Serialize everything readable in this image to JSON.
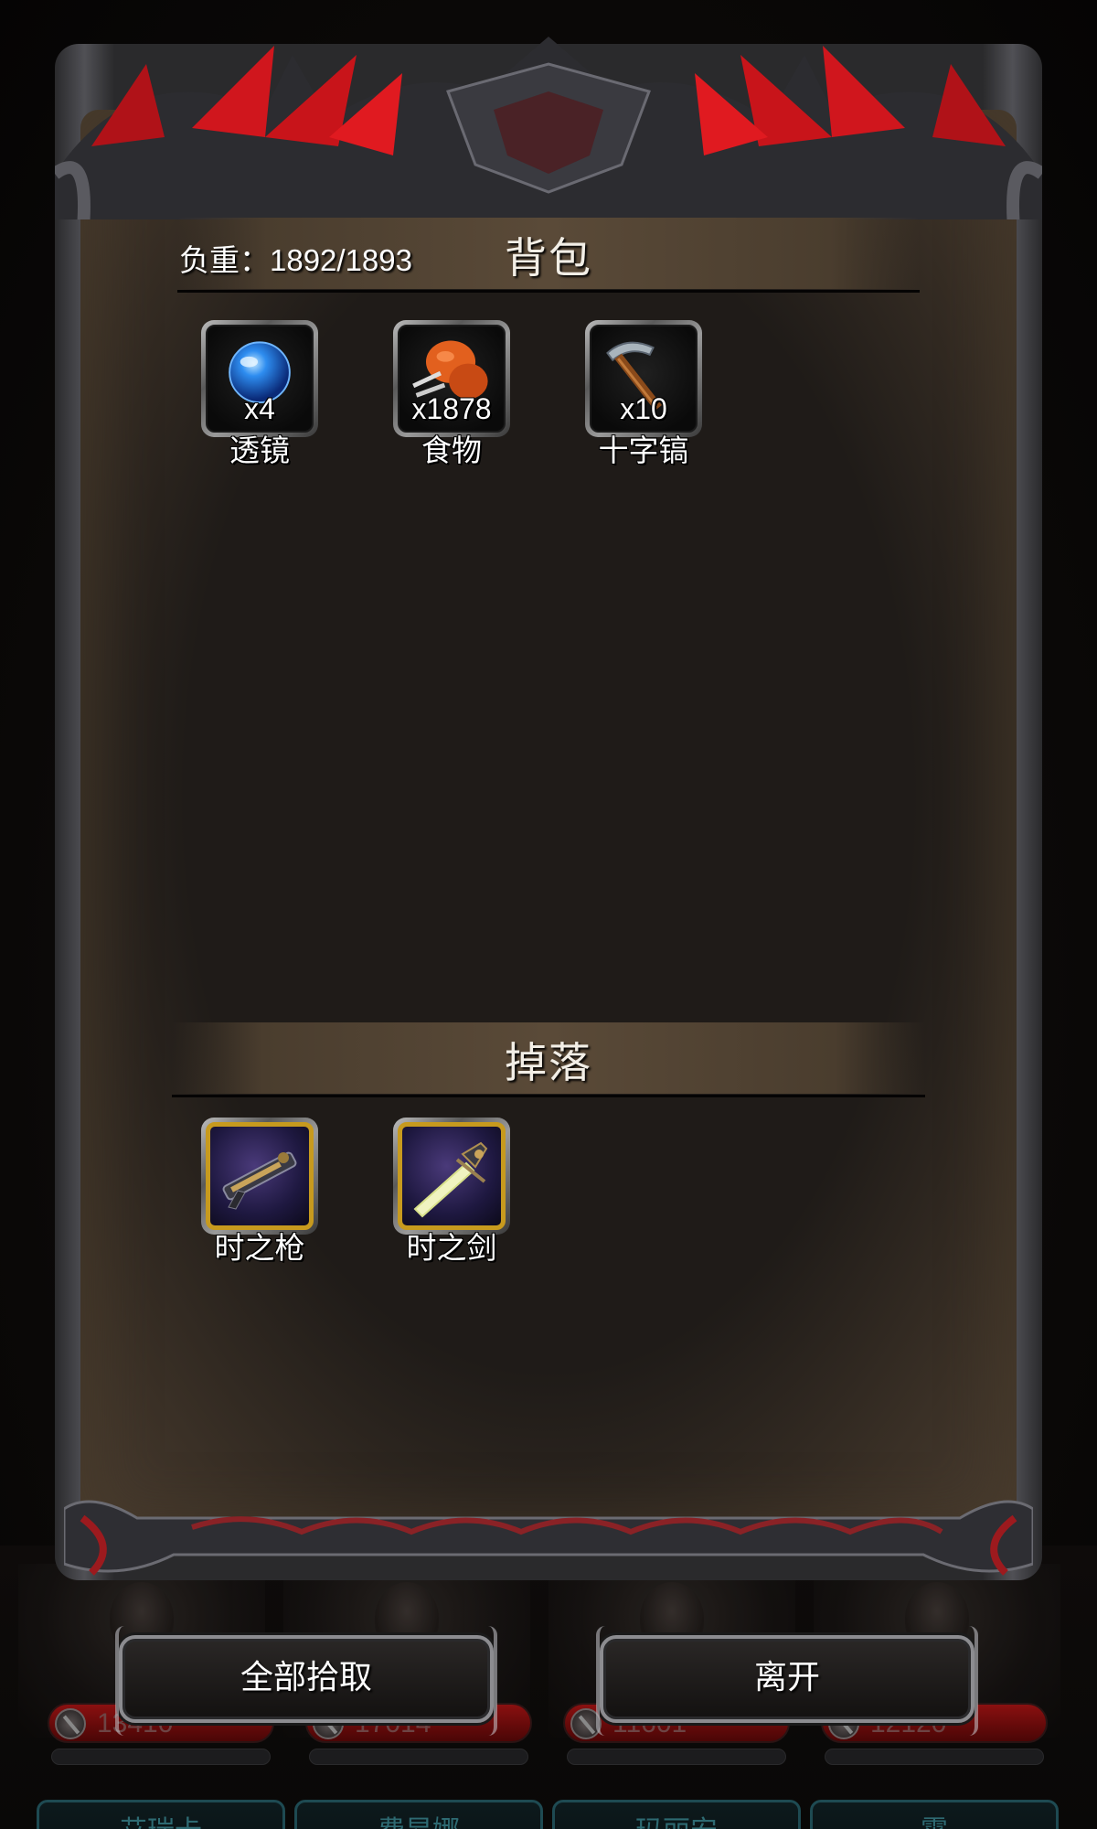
{
  "backpack": {
    "title": "背包",
    "weight_label": "负重：",
    "weight_value": "1892/1893",
    "items": [
      {
        "name": "透镜",
        "count": "x4",
        "icon": "blue-orb-lens-icon"
      },
      {
        "name": "食物",
        "count": "x1878",
        "icon": "roast-meat-food-icon"
      },
      {
        "name": "十字镐",
        "count": "x10",
        "icon": "pickaxe-icon"
      }
    ]
  },
  "drops": {
    "title": "掉落",
    "items": [
      {
        "name": "时之枪",
        "icon": "time-gun-icon"
      },
      {
        "name": "时之剑",
        "icon": "time-sword-icon"
      }
    ]
  },
  "buttons": {
    "pick_all": "全部拾取",
    "leave": "离开"
  },
  "party": [
    {
      "name": "艾瑞卡",
      "hp": "13410"
    },
    {
      "name": "费昂娜",
      "hp": "17014"
    },
    {
      "name": "玛丽安",
      "hp": "11601"
    },
    {
      "name": "霄",
      "hp": "12120"
    }
  ],
  "colors": {
    "panel_bg": "#1f1b18",
    "header_bar": "#5a4a38",
    "crown_red": "#c8141a",
    "slot_gold": "#c79a1e",
    "hp_red": "#8a1010",
    "name_plate": "#1e4a52"
  }
}
